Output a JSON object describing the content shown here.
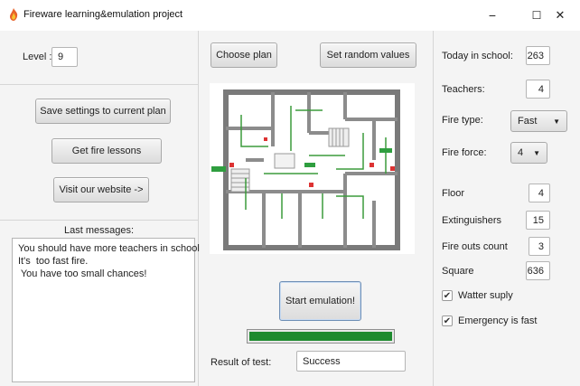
{
  "window": {
    "title": "Fireware learning&emulation project",
    "controls": {
      "minimize": "−",
      "maximize": "☐",
      "close": "✕"
    }
  },
  "left": {
    "level_label": "Level :",
    "level_value": "9",
    "save_button": "Save settings to current plan",
    "lessons_button": "Get fire lessons",
    "website_button": "Visit our website ->",
    "messages_title": "Last messages:",
    "messages": [
      "You should have more teachers in school",
      "It's  too fast fire.",
      " You have too small chances!"
    ]
  },
  "center": {
    "choose_plan_button": "Choose plan",
    "random_button": "Set random  values",
    "start_button": "Start emulation!",
    "progress_fraction": 1.0,
    "result_label": "Result of test:",
    "result_value": "Success"
  },
  "right": {
    "fields": [
      {
        "label": "Today in school:",
        "value": "263"
      },
      {
        "label": "Teachers:",
        "value": "4"
      }
    ],
    "fire_type_label": "Fire type:",
    "fire_type_value": "Fast",
    "fire_force_label": "Fire force:",
    "fire_force_value": "4",
    "fields2": [
      {
        "label": "Floor",
        "value": "4"
      },
      {
        "label": "Extinguishers",
        "value": "15"
      },
      {
        "label": "Fire outs count",
        "value": "3"
      },
      {
        "label": "Square",
        "value": "636"
      }
    ],
    "checkboxes": [
      {
        "label": "Watter suply",
        "checked": true
      },
      {
        "label": "Emergency is fast",
        "checked": true
      }
    ]
  },
  "colors": {
    "progress": "#1d8a2e",
    "pane": "#f4f4f4"
  }
}
